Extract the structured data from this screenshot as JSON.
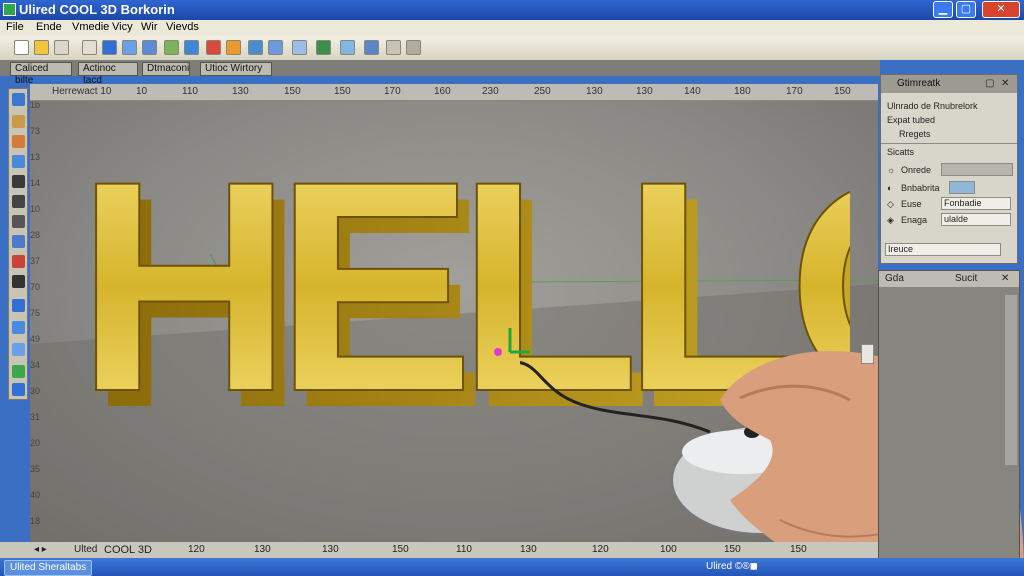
{
  "window": {
    "title": "Ulired COOL 3D Borkorin",
    "min_glyph": "▁",
    "max_glyph": "▢",
    "close_glyph": "✕"
  },
  "menu": [
    "File",
    "Ende",
    "Vmedie",
    "Vicy",
    "Wir",
    "Vievds"
  ],
  "tabs": [
    "Caliced bilte",
    "Actinoc tacd",
    "Dtmaconi",
    "Utioc Wirtory"
  ],
  "ruler_top": [
    "Herrewact 10",
    "10",
    "110",
    "130",
    "150",
    "150",
    "170",
    "160",
    "230",
    "250",
    "130",
    "130",
    "140",
    "180",
    "170",
    "150"
  ],
  "ruler_left": [
    "1b",
    "73",
    "13",
    "14",
    "10",
    "28",
    "37",
    "70",
    "75",
    "49",
    "34",
    "30",
    "31",
    "20",
    "35",
    "40",
    "18"
  ],
  "scene": {
    "text": "HELLO",
    "gold_light": "#f7e27a",
    "gold_mid": "#d6b42c",
    "gold_dark": "#8a6a0a"
  },
  "statusbar": {
    "left_icons": "◂ ▸",
    "label": "Ulted",
    "app": "COOL 3D",
    "ticks": [
      "120",
      "130",
      "130",
      "150",
      "110",
      "130",
      "120",
      "100",
      "150",
      "150"
    ]
  },
  "properties_panel": {
    "title": "Gtimreatk",
    "close": "✕",
    "pin": "▢",
    "items": [
      "Ulnrado de Rnubrelork",
      "Expat tubed",
      "Rregets"
    ],
    "section": "Sicatts",
    "rows": [
      {
        "icon": "☼",
        "label": "Onrede",
        "value": ""
      },
      {
        "icon": "◐",
        "label": "Bnbabrita",
        "value": ""
      },
      {
        "icon": "◇",
        "label": "Euse",
        "value": "Fonbadie"
      },
      {
        "icon": "◈",
        "label": "Enaga",
        "value": "ulalde"
      }
    ],
    "footer_field": "Ireuce"
  },
  "layers_panel": {
    "title": "Gda",
    "right_label": "Sucit",
    "close": "✕"
  },
  "taskbar": {
    "task": "Ulited Sheraltabs",
    "tray": "Ulired ©®◼"
  }
}
